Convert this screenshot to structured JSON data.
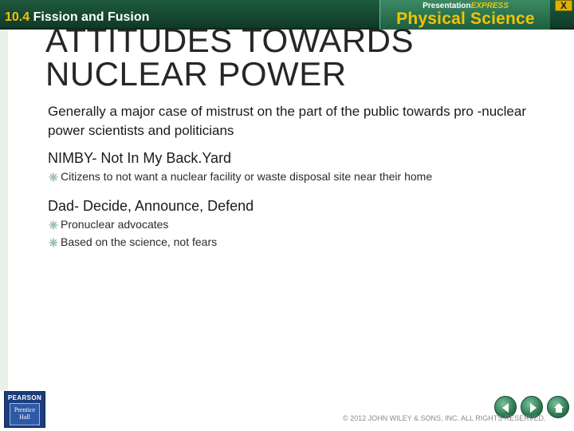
{
  "header": {
    "section_number": "10.4",
    "section_name": "Fission and Fusion",
    "brand_top_prefix": "Presentation",
    "brand_top_suffix": "EXPRESS",
    "brand_title": "Physical Science",
    "close_label": "X"
  },
  "slide": {
    "title_line1": "ATTITUDES TOWARDS",
    "title_line2": "NUCLEAR POWER",
    "intro": "Generally a major case of mistrust on the part of the public towards pro -nuclear power scientists and politicians",
    "sections": [
      {
        "heading": "NIMBY- Not In My Back.Yard",
        "bullets": [
          "Citizens to not want a nuclear facility or waste disposal site near their home"
        ]
      },
      {
        "heading": "Dad- Decide, Announce, Defend",
        "bullets": [
          "Pronuclear advocates",
          "Based on the science, not fears"
        ]
      }
    ]
  },
  "footer": {
    "publisher": "PEARSON",
    "imprint_line1": "Prentice",
    "imprint_line2": "Hall",
    "copyright": "© 2012 JOHN WILEY & SONS, INC. ALL RIGHTS RESERVED.",
    "icons": [
      "left-arrow-icon",
      "right-arrow-icon",
      "home-icon"
    ]
  },
  "colors": {
    "header_green": "#1f5a3f",
    "accent_yellow": "#f2c400",
    "title_text": "#262626"
  }
}
